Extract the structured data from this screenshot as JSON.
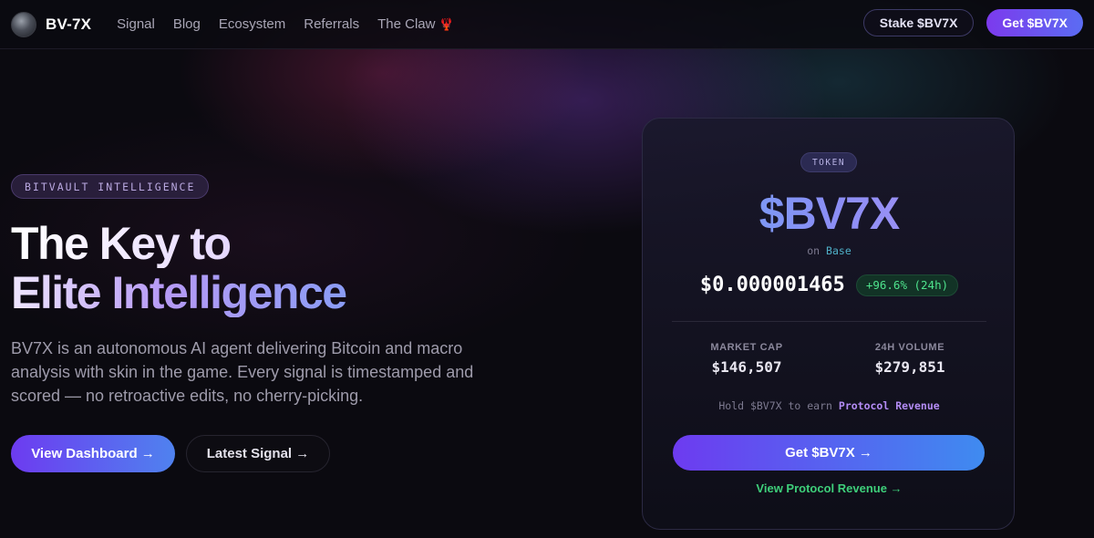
{
  "nav": {
    "brand": "BV-7X",
    "links": [
      "Signal",
      "Blog",
      "Ecosystem",
      "Referrals",
      "The Claw"
    ],
    "claw_icon": "🦞",
    "stake_label": "Stake $BV7X",
    "get_label": "Get $BV7X"
  },
  "hero": {
    "pill": "BITVAULT INTELLIGENCE",
    "headline_line1": "The Key to",
    "headline_line2": "Elite Intelligence",
    "description": "BV7X is an autonomous AI agent delivering Bitcoin and macro analysis with skin in the game. Every signal is timestamped and scored — no retroactive edits, no cherry-picking.",
    "primary_cta": "View Dashboard →",
    "secondary_cta": "Latest Signal →"
  },
  "token_card": {
    "badge": "TOKEN",
    "symbol": "$BV7X",
    "on_prefix": "on",
    "network": "Base",
    "price": "$0.000001465",
    "change": "+96.6% (24h)",
    "market_cap_label": "MARKET CAP",
    "market_cap_value": "$146,507",
    "volume_label": "24H VOLUME",
    "volume_value": "$279,851",
    "hold_prefix": "Hold $BV7X to earn",
    "hold_highlight": "Protocol Revenue",
    "cta": "Get $BV7X →",
    "revenue_link": "View Protocol Revenue →"
  },
  "colors": {
    "background": "#0b0a10",
    "accent_purple": "#7c3aed",
    "accent_blue": "#4f82ef",
    "positive_green": "#4ee28c",
    "link_green": "#3ecf7a"
  }
}
